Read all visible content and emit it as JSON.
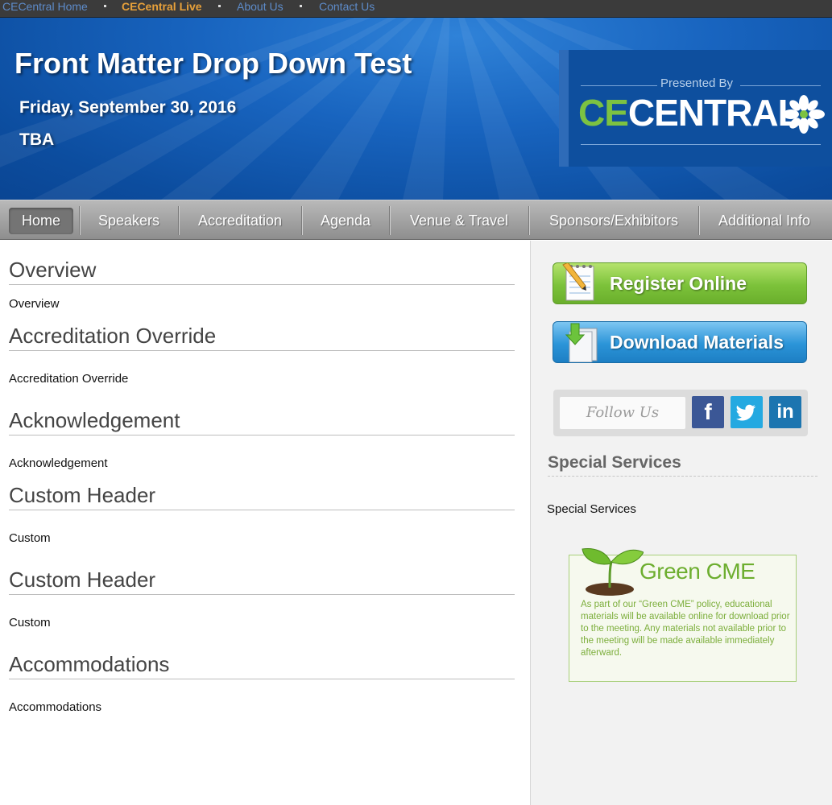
{
  "topbar": {
    "links": [
      {
        "label": "CECentral Home",
        "active": false
      },
      {
        "label": "CECentral Live",
        "active": true
      },
      {
        "label": "About Us",
        "active": false
      },
      {
        "label": "Contact Us",
        "active": false
      }
    ]
  },
  "banner": {
    "title": "Front Matter Drop Down Test",
    "date": "Friday, September 30, 2016",
    "location": "TBA",
    "presented_by": "Presented By",
    "logo_part1": "CE",
    "logo_part2": "CENTRAL"
  },
  "nav": {
    "items": [
      {
        "label": "Home",
        "active": true
      },
      {
        "label": "Speakers"
      },
      {
        "label": "Accreditation"
      },
      {
        "label": "Agenda"
      },
      {
        "label": "Venue & Travel"
      },
      {
        "label": "Sponsors/Exhibitors"
      },
      {
        "label": "Additional Info"
      }
    ]
  },
  "main": {
    "sections": [
      {
        "heading": "Overview",
        "text": "Overview"
      },
      {
        "heading": "Accreditation Override",
        "text": "Accreditation Override"
      },
      {
        "heading": "Acknowledgement",
        "text": "Acknowledgement"
      },
      {
        "heading": "Custom Header",
        "text": "Custom"
      },
      {
        "heading": "Custom Header",
        "text": "Custom"
      },
      {
        "heading": "Accommodations",
        "text": "Accommodations"
      }
    ]
  },
  "sidebar": {
    "register_label": "Register Online",
    "download_label": "Download Materials",
    "follow_label": "Follow Us",
    "social": {
      "facebook": "f",
      "linkedin": "in"
    },
    "special_heading": "Special Services",
    "special_text": "Special Services",
    "green": {
      "title": "Green CME",
      "description": "As part of our “Green CME” policy, educational materials will be available online for download prior to the meeting. Any materials not available prior to the meeting will be made available immediately afterward."
    }
  },
  "colors": {
    "topbar_link": "#5d8bc9",
    "topbar_active": "#e8a13a",
    "banner_blue": "#1864bf",
    "logo_green": "#7cc242",
    "nav_gray": "#a0a0a0",
    "register_green": "#7cc23a",
    "download_blue": "#2b94d8",
    "facebook": "#3b5796",
    "twitter": "#24a9e1",
    "linkedin": "#1c75b0",
    "green_cme": "#6dae2f"
  }
}
